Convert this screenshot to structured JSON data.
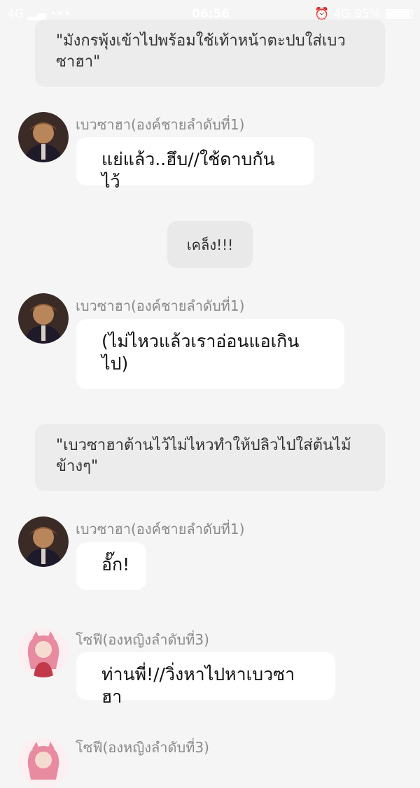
{
  "status_bar": {
    "network": "4G",
    "dots": "•••",
    "time": "06:56",
    "network_right": "4G",
    "battery": "95%"
  },
  "messages": [
    {
      "type": "narration",
      "text": "\"มังกรพุ้งเข้าไปพร้อมใช้เท้าหน้าตะปบใส่เบวซาฮา\""
    },
    {
      "type": "chat",
      "name": "เบวซาฮา(องค์ชายลำดับที่1)",
      "text": "แย่แล้ว..ฮึบ//ใช้ดาบกันไว้",
      "avatar": "beausaha-avatar"
    },
    {
      "type": "system",
      "text": "เคล็ง!!!"
    },
    {
      "type": "chat",
      "name": "เบวซาฮา(องค์ชายลำดับที่1)",
      "text": "(ไม่ไหวแล้วเราอ่อนแอเกินไป)",
      "avatar": "beausaha-avatar"
    },
    {
      "type": "narration",
      "text": "\"เบวซาฮาต้านไว้ไม่ไหวทำให้ปลิวไปใส่ต้นไม้ข้างๆ\""
    },
    {
      "type": "chat",
      "name": "เบวซาฮา(องค์ชายลำดับที่1)",
      "text": "อั๊ก!",
      "avatar": "beausaha-avatar"
    },
    {
      "type": "chat",
      "name": "โซฟี(องหญิงลำดับที่3)",
      "text": "ท่านพี่!//วิ่งหาไปหาเบวซาฮา",
      "avatar": "sophie-avatar"
    },
    {
      "type": "chat",
      "name": "โซฟี(องหญิงลำดับที่3)",
      "text": "",
      "avatar": "sophie-avatar"
    }
  ]
}
